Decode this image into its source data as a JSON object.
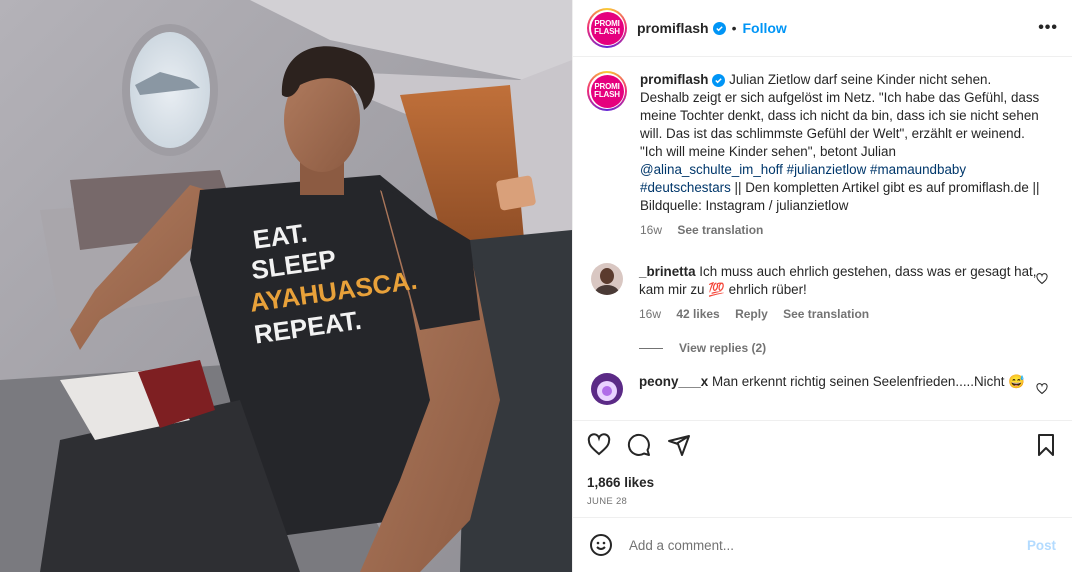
{
  "post": {
    "username": "promiflash",
    "follow_label": "Follow",
    "dot": "•",
    "more_label": "•••",
    "logo_top": "PROMI",
    "logo_bottom": "FLASH",
    "caption_text_1": " Julian Zietlow darf seine Kinder nicht sehen. Deshalb zeigt er sich aufgelöst im Netz. \"Ich habe das Gefühl, dass meine Tochter denkt, dass ich nicht da bin, dass ich sie nicht sehen will. Das ist das schlimmste Gefühl der Welt\", erzählt er weinend. \"Ich will meine Kinder sehen\", betont Julian ",
    "caption_mention": "@alina_schulte_im_hoff",
    "caption_tag_1": "#julianzietlow",
    "caption_tag_2": "#mamaundbaby",
    "caption_tag_3": "#deutschestars",
    "caption_text_2": " || Den kompletten Artikel gibt es auf promiflash.de || Bildquelle: Instagram / julianzietlow",
    "caption_age": "16w",
    "see_translation": "See translation",
    "likes": "1,866 likes",
    "date": "JUNE 28",
    "shirt_text": [
      "EAT.",
      "SLEEP",
      "AYAHUASCA.",
      "REPEAT."
    ]
  },
  "comments": [
    {
      "username": "_brinetta",
      "text": "Ich muss auch ehrlich gestehen, dass was er gesagt hat, kam mir zu",
      "text_after": " ehrlich rüber!",
      "emoji": "💯",
      "age": "16w",
      "likes": "42 likes",
      "reply": "Reply",
      "see_translation": "See translation",
      "view_replies": "View replies (2)"
    },
    {
      "username": "peony___x",
      "text": "Man erkennt richtig seinen Seelenfrieden.....Nicht",
      "emoji": "😅"
    }
  ],
  "add_comment": {
    "placeholder": "Add a comment...",
    "post_label": "Post"
  },
  "colors": {
    "brand": "#e5007e",
    "link": "#00376b",
    "follow": "#0095f6",
    "post_disabled": "#b3dbff"
  },
  "icons": [
    "heart-icon",
    "comment-icon",
    "share-icon",
    "bookmark-icon",
    "emoji-icon",
    "verified-icon",
    "more-icon"
  ]
}
